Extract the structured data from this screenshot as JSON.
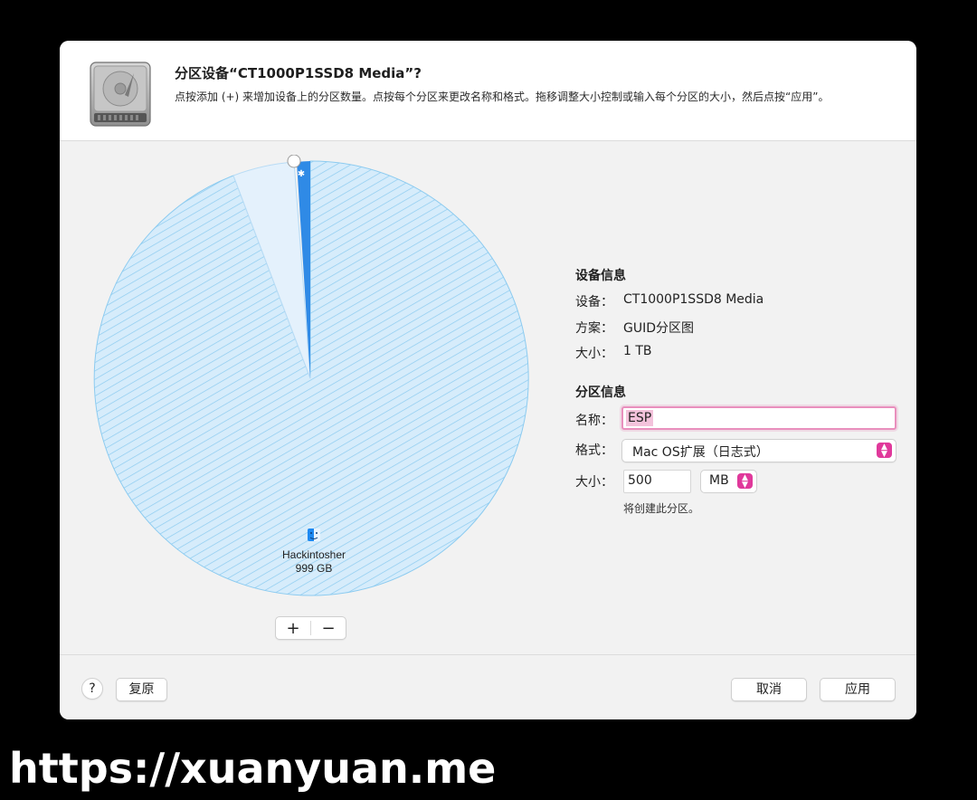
{
  "header": {
    "title": "分区设备“CT1000P1SSD8 Media”?",
    "subtitle": "点按添加 (+) 来增加设备上的分区数量。点按每个分区来更改名称和格式。拖移调整大小控制或输入每个分区的大小，然后点按“应用”。",
    "icon": "hard-disk-icon"
  },
  "pie": {
    "partition_label": "Hackintosher",
    "partition_size": "999 GB",
    "partition_icon": "finder-icon"
  },
  "partition_controls": {
    "add": "+",
    "remove": "−"
  },
  "device_info": {
    "heading": "设备信息",
    "rows": [
      {
        "label": "设备：",
        "value": "CT1000P1SSD8 Media"
      },
      {
        "label": "方案：",
        "value": "GUID分区图"
      },
      {
        "label": "大小：",
        "value": "1 TB"
      }
    ]
  },
  "partition_info": {
    "heading": "分区信息",
    "name_label": "名称：",
    "name_value": "ESP",
    "format_label": "格式：",
    "format_value": "Mac OS扩展（日志式）",
    "size_label": "大小：",
    "size_value": "500",
    "size_unit": "MB",
    "note": "将创建此分区。"
  },
  "footer": {
    "help": "?",
    "revert": "复原",
    "cancel": "取消",
    "apply": "应用"
  },
  "colors": {
    "accent": "#e0399b",
    "pie_fill": "#d6ecfb",
    "pie_hatch": "#7cc4ee",
    "selected_slice": "#2f8ae6"
  },
  "watermark": "https://xuanyuan.me"
}
